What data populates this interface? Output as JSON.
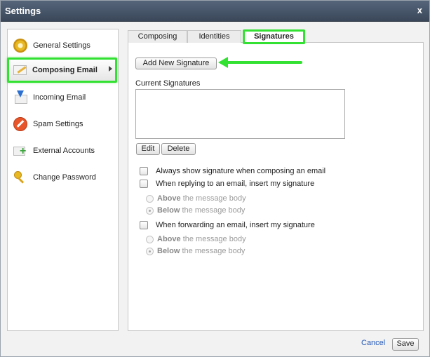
{
  "window": {
    "title": "Settings",
    "close_label": "x"
  },
  "sidebar": {
    "items": [
      {
        "label": "General Settings",
        "icon": "gear-icon"
      },
      {
        "label": "Composing Email",
        "icon": "pencil-icon",
        "active": true
      },
      {
        "label": "Incoming Email",
        "icon": "incoming-mail-icon"
      },
      {
        "label": "Spam Settings",
        "icon": "no-entry-icon"
      },
      {
        "label": "External Accounts",
        "icon": "add-account-icon"
      },
      {
        "label": "Change Password",
        "icon": "key-icon"
      }
    ]
  },
  "tabs": [
    {
      "label": "Composing"
    },
    {
      "label": "Identities"
    },
    {
      "label": "Signatures",
      "active": true
    }
  ],
  "signatures": {
    "add_button": "Add New Signature",
    "current_label": "Current Signatures",
    "edit_button": "Edit",
    "delete_button": "Delete",
    "options": {
      "always_show": "Always show signature when composing an email",
      "replying": "When replying to an email, insert my signature",
      "forwarding": "When forwarding an email, insert my signature",
      "above_bold": "Above",
      "below_bold": "Below",
      "message_body_suffix": "the message body"
    }
  },
  "footer": {
    "cancel": "Cancel",
    "save": "Save"
  },
  "colors": {
    "highlight": "#33e133",
    "titlebar": "#4a586c",
    "link": "#2459b8"
  }
}
